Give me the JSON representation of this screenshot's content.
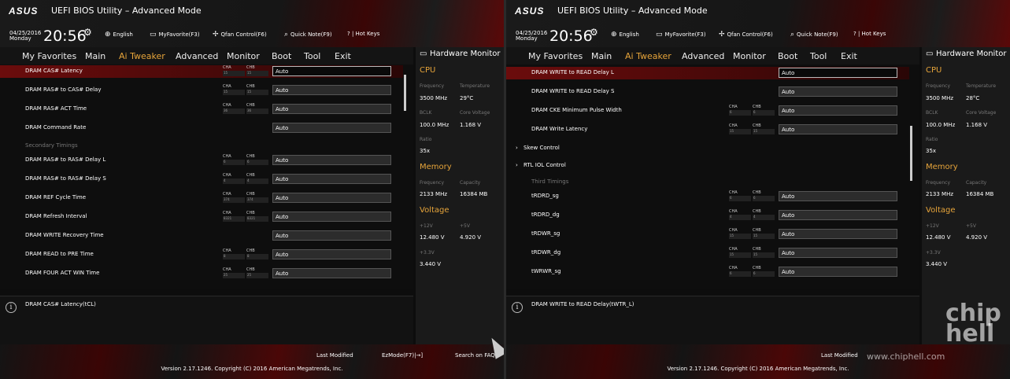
{
  "header": {
    "logo": "ASUS",
    "title": "UEFI BIOS Utility – Advanced Mode",
    "date_line1": "04/25/2016",
    "date_line2": "Monday",
    "time": "20:56",
    "tools": [
      {
        "icon": "globe-icon",
        "label": "English"
      },
      {
        "icon": "monitor-icon",
        "label": "MyFavorite(F3)"
      },
      {
        "icon": "fan-icon",
        "label": "Qfan Control(F6)"
      },
      {
        "icon": "search-icon",
        "label": "Quick Note(F9)"
      },
      {
        "icon": "help-icon",
        "label": "? | Hot Keys"
      }
    ]
  },
  "tabs": [
    {
      "label": "My Favorites"
    },
    {
      "label": "Main"
    },
    {
      "label": "Ai Tweaker",
      "active": true
    },
    {
      "label": "Advanced"
    },
    {
      "label": "Monitor"
    },
    {
      "label": "Boot"
    },
    {
      "label": "Tool"
    },
    {
      "label": "Exit"
    }
  ],
  "channel_labels": {
    "a": "CHA",
    "b": "CHB"
  },
  "left": {
    "rows": [
      {
        "label": "DRAM CAS# Latency",
        "value": "Auto",
        "ch": true,
        "cha": "15",
        "chb": "15",
        "selected": true
      },
      {
        "label": "DRAM RAS# to CAS# Delay",
        "value": "Auto",
        "ch": true,
        "cha": "15",
        "chb": "15"
      },
      {
        "label": "DRAM RAS# ACT Time",
        "value": "Auto",
        "ch": true,
        "cha": "36",
        "chb": "36"
      },
      {
        "label": "DRAM Command Rate",
        "value": "Auto",
        "ch": false
      },
      {
        "label": "Secondary Timings",
        "group": true
      },
      {
        "label": "DRAM RAS# to RAS# Delay L",
        "value": "Auto",
        "ch": true,
        "cha": "6",
        "chb": "6"
      },
      {
        "label": "DRAM RAS# to RAS# Delay S",
        "value": "Auto",
        "ch": true,
        "cha": "4",
        "chb": "4"
      },
      {
        "label": "DRAM REF Cycle Time",
        "value": "Auto",
        "ch": true,
        "cha": "374",
        "chb": "374"
      },
      {
        "label": "DRAM Refresh Interval",
        "value": "Auto",
        "ch": true,
        "cha": "8321",
        "chb": "8321"
      },
      {
        "label": "DRAM WRITE Recovery Time",
        "value": "Auto",
        "ch": false
      },
      {
        "label": "DRAM READ to PRE Time",
        "value": "Auto",
        "ch": true,
        "cha": "8",
        "chb": "8"
      },
      {
        "label": "DRAM FOUR ACT WIN Time",
        "value": "Auto",
        "ch": true,
        "cha": "25",
        "chb": "25"
      }
    ],
    "help": "DRAM CAS# Latency(tCL)",
    "monitor": {
      "title": "Hardware Monitor",
      "cpu": "CPU",
      "frequency_label": "Frequency",
      "frequency": "3500 MHz",
      "temperature_label": "Temperature",
      "temperature": "29°C",
      "bclk_label": "BCLK",
      "bclk": "100.0 MHz",
      "core_voltage_label": "Core Voltage",
      "core_voltage": "1.168 V",
      "ratio_label": "Ratio",
      "ratio": "35x",
      "memory": "Memory",
      "mem_freq_label": "Frequency",
      "mem_freq": "2133 MHz",
      "capacity_label": "Capacity",
      "capacity": "16384 MB",
      "voltage": "Voltage",
      "v12_label": "+12V",
      "v12": "12.480 V",
      "v5_label": "+5V",
      "v5": "4.920 V",
      "v33_label": "+3.3V",
      "v33": "3.440 V"
    }
  },
  "right": {
    "rows": [
      {
        "label": "DRAM WRITE to READ Delay L",
        "value": "Auto",
        "ch": false,
        "selected": true
      },
      {
        "label": "DRAM WRITE to READ Delay S",
        "value": "Auto",
        "ch": false
      },
      {
        "label": "DRAM CKE Minimum Pulse Width",
        "value": "Auto",
        "ch": true,
        "cha": "6",
        "chb": "6"
      },
      {
        "label": "DRAM Write Latency",
        "value": "Auto",
        "ch": true,
        "cha": "15",
        "chb": "15"
      },
      {
        "label": "Skew Control",
        "expand": true
      },
      {
        "label": "RTL IOL Control",
        "expand": true
      },
      {
        "label": "Third Timings",
        "group": true
      },
      {
        "label": "tRDRD_sg",
        "value": "Auto",
        "ch": true,
        "cha": "6",
        "chb": "6"
      },
      {
        "label": "tRDRD_dg",
        "value": "Auto",
        "ch": true,
        "cha": "4",
        "chb": "4"
      },
      {
        "label": "tRDWR_sg",
        "value": "Auto",
        "ch": true,
        "cha": "15",
        "chb": "15"
      },
      {
        "label": "tRDWR_dg",
        "value": "Auto",
        "ch": true,
        "cha": "15",
        "chb": "15"
      },
      {
        "label": "tWRWR_sg",
        "value": "Auto",
        "ch": true,
        "cha": "6",
        "chb": "6"
      }
    ],
    "help": "DRAM WRITE to READ Delay(tWTR_L)",
    "monitor": {
      "title": "Hardware Monitor",
      "cpu": "CPU",
      "frequency_label": "Frequency",
      "frequency": "3500 MHz",
      "temperature_label": "Temperature",
      "temperature": "28°C",
      "bclk_label": "BCLK",
      "bclk": "100.0 MHz",
      "core_voltage_label": "Core Voltage",
      "core_voltage": "1.168 V",
      "ratio_label": "Ratio",
      "ratio": "35x",
      "memory": "Memory",
      "mem_freq_label": "Frequency",
      "mem_freq": "2133 MHz",
      "capacity_label": "Capacity",
      "capacity": "16384 MB",
      "voltage": "Voltage",
      "v12_label": "+12V",
      "v12": "12.480 V",
      "v5_label": "+5V",
      "v5": "4.920 V",
      "v33_label": "+3.3V",
      "v33": "3.440 V"
    }
  },
  "footer": {
    "last_modified": "Last Modified",
    "ezmode": "EzMode(F7)|→]",
    "search": "Search on FAQ",
    "version": "Version 2.17.1246. Copyright (C) 2016 American Megatrends, Inc."
  },
  "watermark": {
    "logo": "chip hell",
    "url": "www.chiphell.com"
  },
  "colors": {
    "accent": "#e6a43a",
    "selected_row": "#6b0c0c",
    "brand_red": "#8b0a0a"
  }
}
